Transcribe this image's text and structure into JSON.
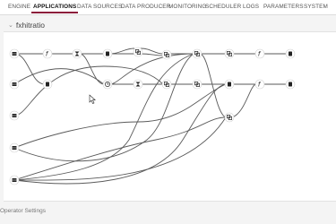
{
  "nav": {
    "tabs": [
      {
        "label": "ENGINE",
        "active": false
      },
      {
        "label": "APPLICATIONS",
        "active": true
      },
      {
        "label": "DATA SOURCES",
        "active": false
      },
      {
        "label": "DATA PRODUCER",
        "active": false
      },
      {
        "label": "MONITORING",
        "active": false
      },
      {
        "label": "SCHEDULER",
        "active": false
      },
      {
        "label": "LOGS",
        "active": false
      },
      {
        "label": "PARAMETERS",
        "active": false
      },
      {
        "label": "SYSTEM",
        "active": false
      }
    ],
    "accent_color": "#8b1a3a"
  },
  "page": {
    "title": "fxhitratio",
    "expand_icon": "chevron-down-icon"
  },
  "graph": {
    "node_icons": [
      "source-icon",
      "function-icon",
      "filter-icon",
      "sink-icon",
      "join-icon",
      "timer-icon"
    ],
    "function_glyph": "f",
    "filter_glyph": "⧗"
  },
  "footer": {
    "label": "Operator Settings"
  }
}
